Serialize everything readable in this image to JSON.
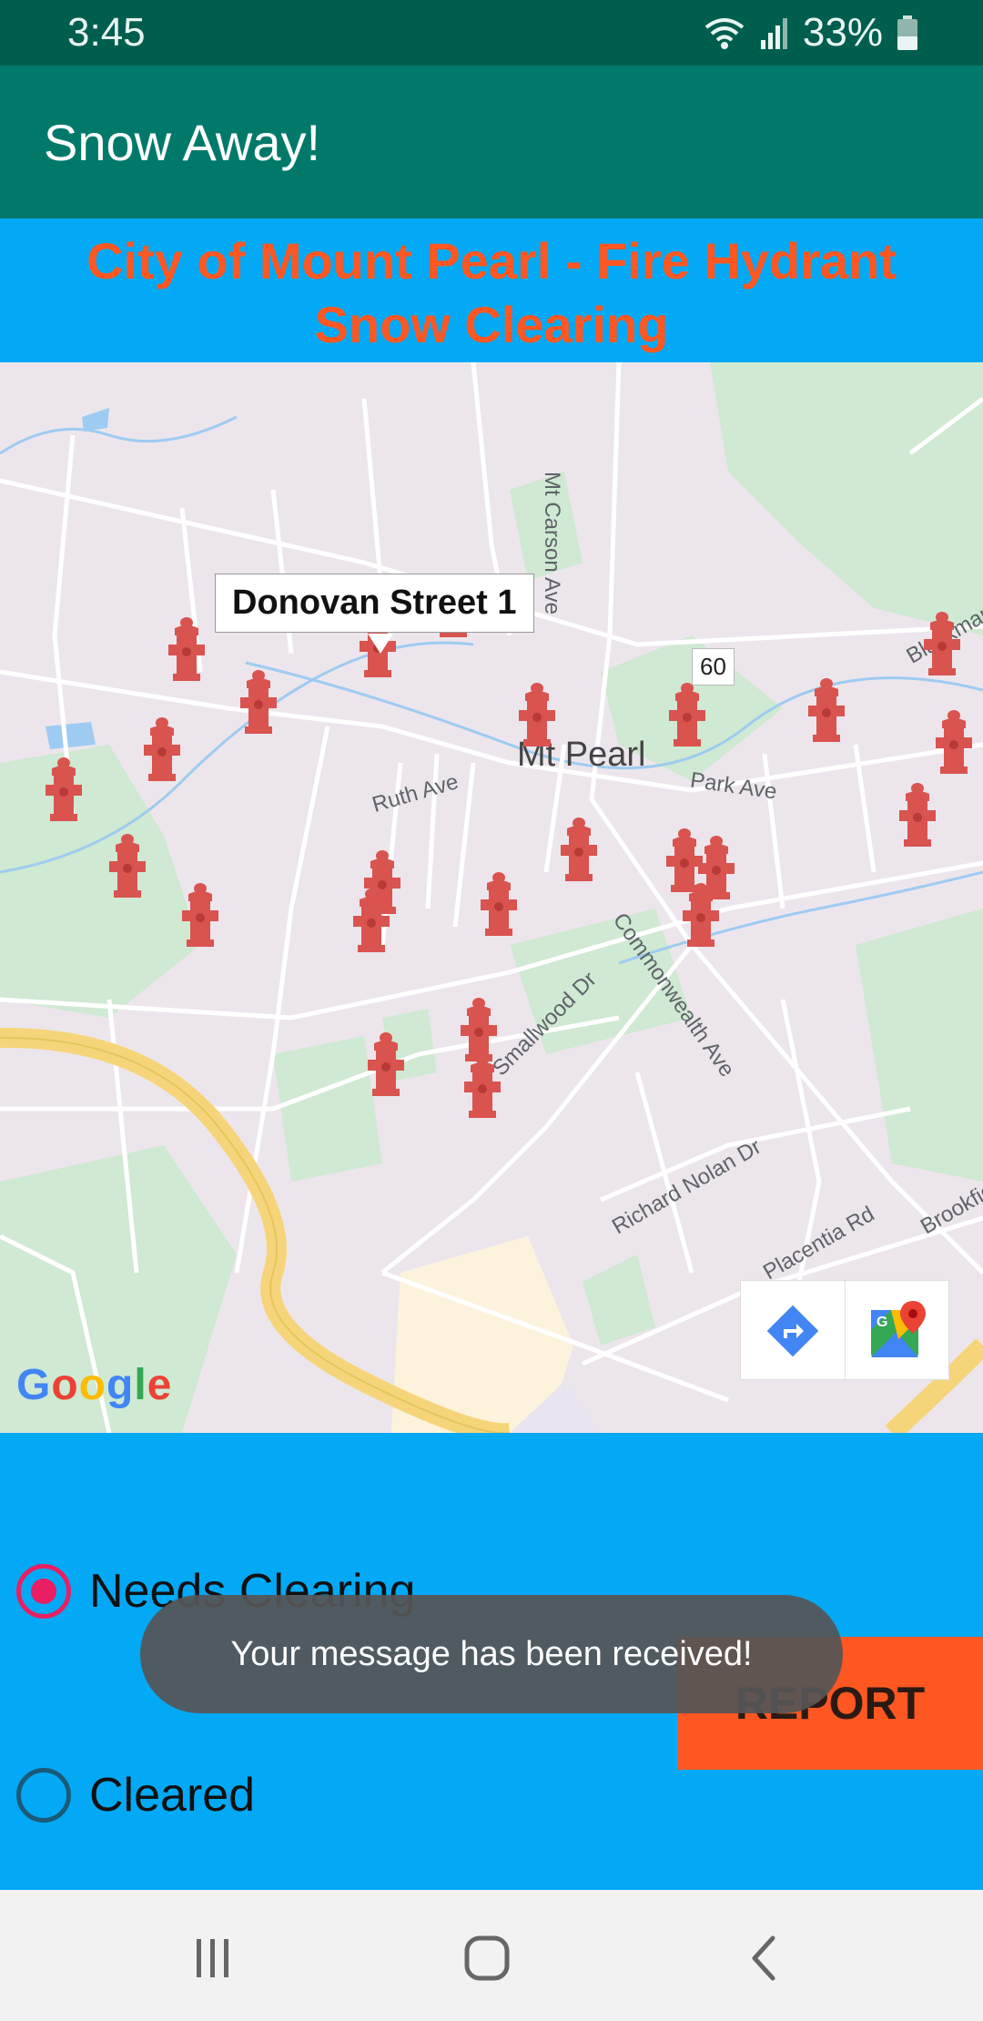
{
  "status_bar": {
    "time": "3:45",
    "battery_text": "33%",
    "icons": [
      "wifi-icon",
      "signal-icon",
      "battery-icon"
    ]
  },
  "app_bar": {
    "title": "Snow Away!"
  },
  "header": {
    "title_line1": "City of Mount Pearl - Fire Hydrant",
    "title_line2": "Snow Clearing"
  },
  "map": {
    "labels": {
      "mt_carson": "Mt Carson Ave",
      "blackmarsh": "Blackmarsh",
      "route": "60",
      "mt_pearl": "Mt Pearl",
      "park": "Park Ave",
      "ruth": "Ruth Ave",
      "commonwealth": "Commonwealth Ave",
      "smallwood": "Smallwood Dr",
      "richard_nolan": "Richard Nolan Dr",
      "brookfield": "Brookfie",
      "placentia": "Placentia Rd"
    },
    "selected_marker": "Donovan Street 1",
    "google_logo": "Google",
    "tools": [
      "directions-icon",
      "google-maps-icon"
    ],
    "colors": {
      "land": "#ece6ec",
      "park": "#cfe9d2",
      "water": "#9ecbf1",
      "highway": "#f6d57a",
      "marker": "#d9534f"
    }
  },
  "controls": {
    "option_needs": "Needs Clearing",
    "option_cleared": "Cleared",
    "selected": "Needs Clearing",
    "report_label": "REPORT"
  },
  "toast": {
    "message": "Your message has been received!"
  },
  "nav_bar": {
    "buttons": [
      "recents-icon",
      "home-icon",
      "back-icon"
    ]
  }
}
